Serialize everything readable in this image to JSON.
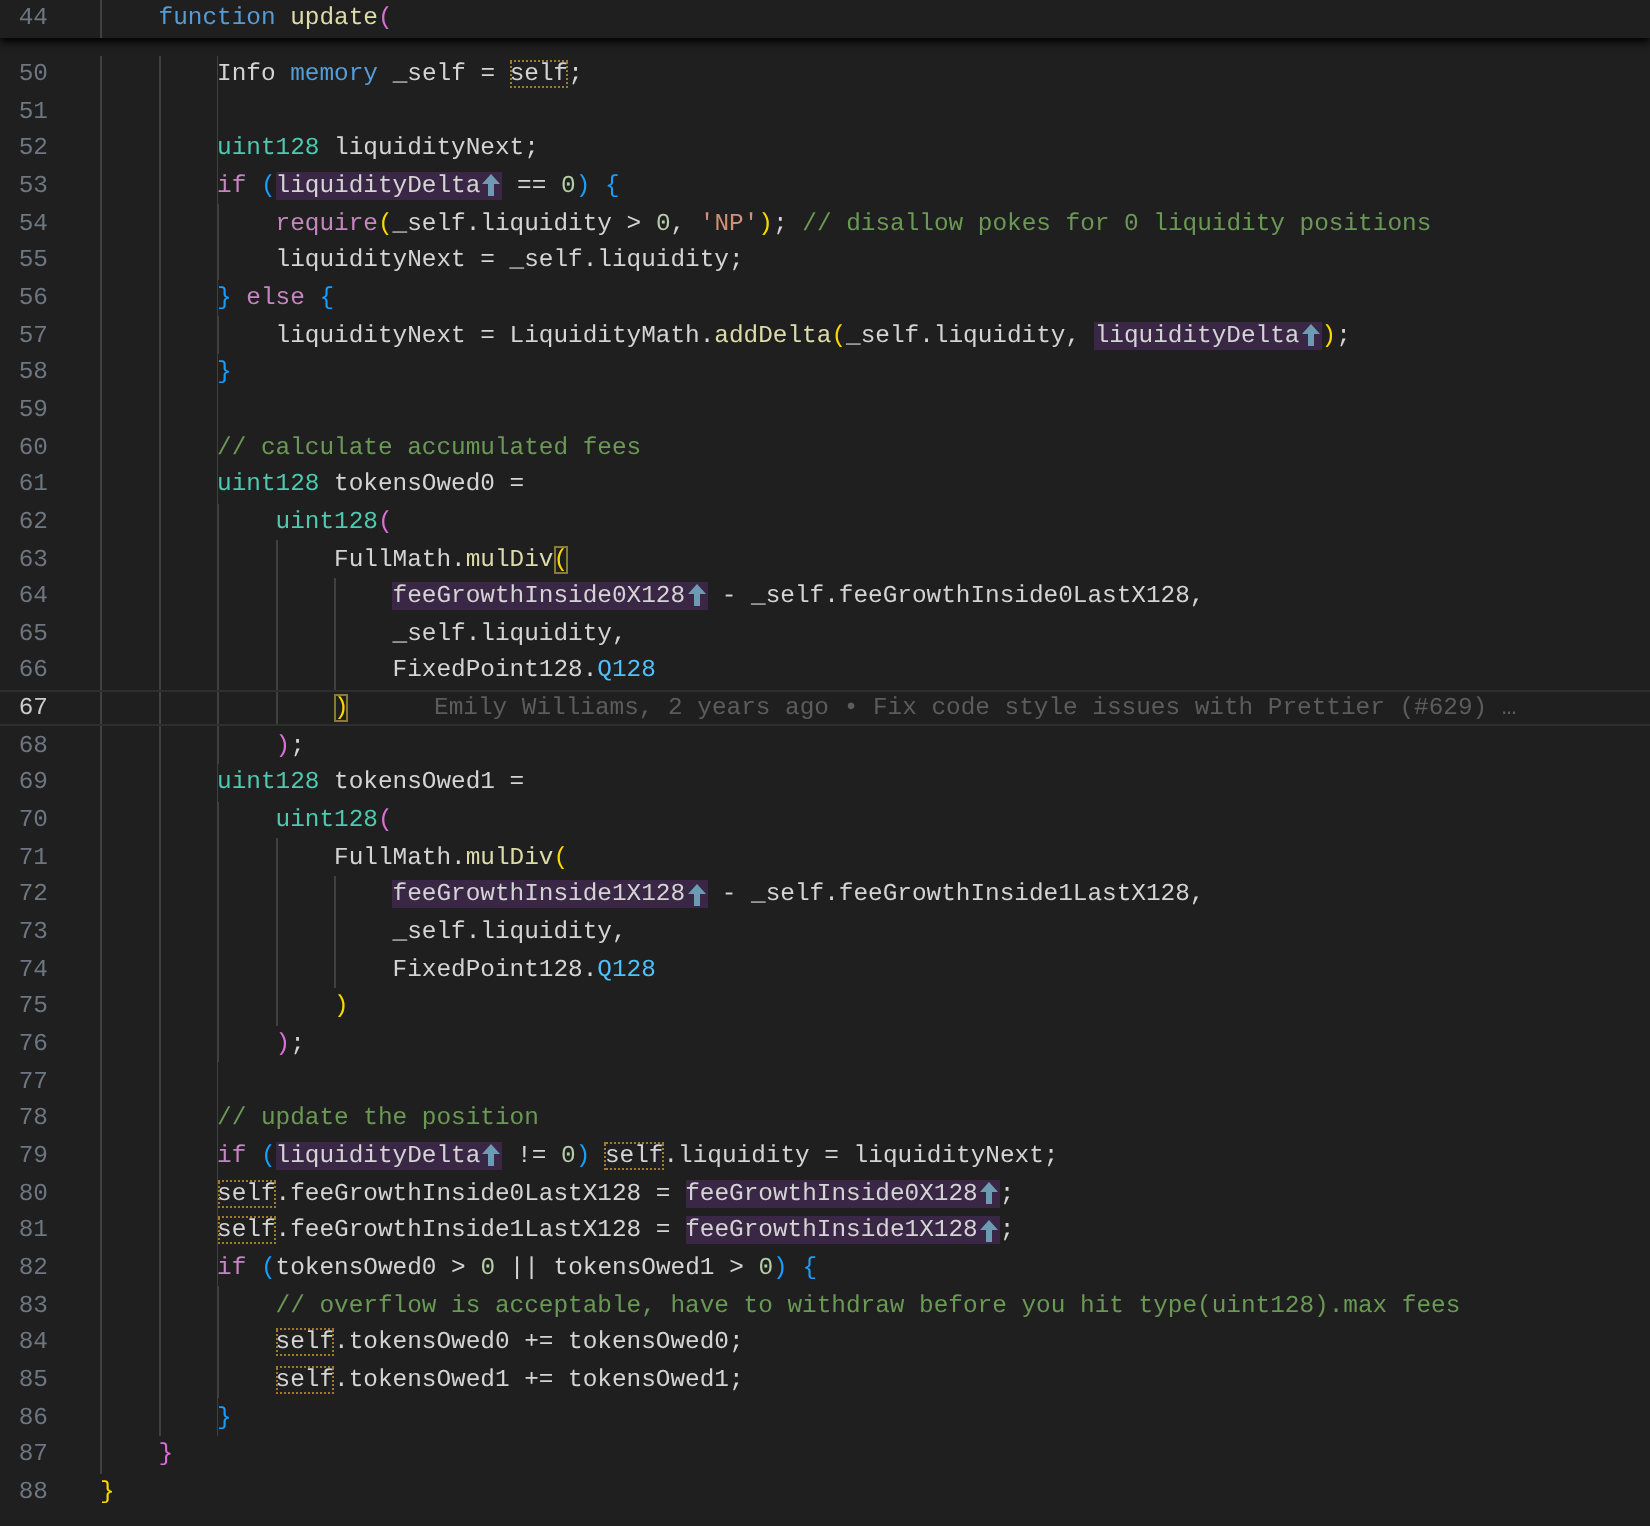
{
  "sticky_line": {
    "number": "44",
    "tokens": [
      {
        "text": "    function",
        "kind": "keyword"
      },
      {
        "text": " update",
        "kind": "function"
      },
      {
        "text": "(",
        "kind": "bracket2"
      }
    ]
  },
  "lines": [
    {
      "number": "50",
      "current": false,
      "tokens": [
        {
          "text": "        Info",
          "kind": "plain"
        },
        {
          "text": " memory",
          "kind": "keyword"
        },
        {
          "text": " _self = ",
          "kind": "plain"
        },
        {
          "text": "self",
          "kind": "self"
        },
        {
          "text": ";",
          "kind": "plain"
        }
      ]
    },
    {
      "number": "51",
      "current": false
    },
    {
      "number": "52",
      "current": false,
      "tokens": [
        {
          "text": "        uint128",
          "kind": "type"
        },
        {
          "text": " liquidityNext;",
          "kind": "plain"
        }
      ]
    },
    {
      "number": "53",
      "current": false,
      "tokens": [
        {
          "text": "        if",
          "kind": "control"
        },
        {
          "text": " (",
          "kind": "bracket3"
        },
        {
          "text": "liquidityDelta",
          "kind": "param"
        },
        {
          "text": " == ",
          "kind": "plain"
        },
        {
          "text": "0",
          "kind": "number"
        },
        {
          "text": ")",
          "kind": "bracket3"
        },
        {
          "text": " {",
          "kind": "bracket3"
        }
      ]
    },
    {
      "number": "54",
      "current": false,
      "tokens": [
        {
          "text": "            require",
          "kind": "control"
        },
        {
          "text": "(",
          "kind": "bracket1"
        },
        {
          "text": "_self.liquidity > ",
          "kind": "plain"
        },
        {
          "text": "0",
          "kind": "number"
        },
        {
          "text": ", ",
          "kind": "plain"
        },
        {
          "text": "'NP'",
          "kind": "string"
        },
        {
          "text": ")",
          "kind": "bracket1"
        },
        {
          "text": "; ",
          "kind": "plain"
        },
        {
          "text": "// disallow pokes for 0 liquidity positions",
          "kind": "comment"
        }
      ]
    },
    {
      "number": "55",
      "current": false,
      "tokens": [
        {
          "text": "            liquidityNext = _self.liquidity;",
          "kind": "plain"
        }
      ]
    },
    {
      "number": "56",
      "current": false,
      "tokens": [
        {
          "text": "        }",
          "kind": "bracket3"
        },
        {
          "text": " else",
          "kind": "control"
        },
        {
          "text": " {",
          "kind": "bracket3"
        }
      ]
    },
    {
      "number": "57",
      "current": false,
      "tokens": [
        {
          "text": "            liquidityNext = LiquidityMath.",
          "kind": "plain"
        },
        {
          "text": "addDelta",
          "kind": "function"
        },
        {
          "text": "(",
          "kind": "bracket1"
        },
        {
          "text": "_self.liquidity, ",
          "kind": "plain"
        },
        {
          "text": "liquidityDelta",
          "kind": "param"
        },
        {
          "text": ")",
          "kind": "bracket1"
        },
        {
          "text": ";",
          "kind": "plain"
        }
      ]
    },
    {
      "number": "58",
      "current": false,
      "tokens": [
        {
          "text": "        }",
          "kind": "bracket3"
        }
      ]
    },
    {
      "number": "59",
      "current": false
    },
    {
      "number": "60",
      "current": false,
      "tokens": [
        {
          "text": "        // calculate accumulated fees",
          "kind": "comment"
        }
      ]
    },
    {
      "number": "61",
      "current": false,
      "tokens": [
        {
          "text": "        uint128",
          "kind": "type"
        },
        {
          "text": " tokensOwed0 =",
          "kind": "plain"
        }
      ]
    },
    {
      "number": "62",
      "current": false,
      "tokens": [
        {
          "text": "            uint128",
          "kind": "type"
        },
        {
          "text": "(",
          "kind": "bracket2"
        }
      ]
    },
    {
      "number": "63",
      "current": false,
      "tokens": [
        {
          "text": "                FullMath.",
          "kind": "plain"
        },
        {
          "text": "mulDiv",
          "kind": "function"
        },
        {
          "text": "(",
          "kind": "match"
        }
      ]
    },
    {
      "number": "64",
      "current": false,
      "tokens": [
        {
          "text": "                    feeGrowthInside0X128",
          "kind": "param"
        },
        {
          "text": " - _self.feeGrowthInside0LastX128,",
          "kind": "plain"
        }
      ]
    },
    {
      "number": "65",
      "current": false,
      "tokens": [
        {
          "text": "                    _self.liquidity,",
          "kind": "plain"
        }
      ]
    },
    {
      "number": "66",
      "current": false,
      "tokens": [
        {
          "text": "                    FixedPoint128.",
          "kind": "plain"
        },
        {
          "text": "Q128",
          "kind": "constant"
        }
      ]
    },
    {
      "number": "67",
      "current": true,
      "blame": "Emily Williams, 2 years ago • Fix code style issues with Prettier (#629) …",
      "tokens": [
        {
          "text": "                )",
          "kind": "match"
        }
      ]
    },
    {
      "number": "68",
      "current": false,
      "tokens": [
        {
          "text": "            )",
          "kind": "bracket2"
        },
        {
          "text": ";",
          "kind": "plain"
        }
      ]
    },
    {
      "number": "69",
      "current": false,
      "tokens": [
        {
          "text": "        uint128",
          "kind": "type"
        },
        {
          "text": " tokensOwed1 =",
          "kind": "plain"
        }
      ]
    },
    {
      "number": "70",
      "current": false,
      "tokens": [
        {
          "text": "            uint128",
          "kind": "type"
        },
        {
          "text": "(",
          "kind": "bracket2"
        }
      ]
    },
    {
      "number": "71",
      "current": false,
      "tokens": [
        {
          "text": "                FullMath.",
          "kind": "plain"
        },
        {
          "text": "mulDiv",
          "kind": "function"
        },
        {
          "text": "(",
          "kind": "bracket1"
        }
      ]
    },
    {
      "number": "72",
      "current": false,
      "tokens": [
        {
          "text": "                    feeGrowthInside1X128",
          "kind": "param"
        },
        {
          "text": " - _self.feeGrowthInside1LastX128,",
          "kind": "plain"
        }
      ]
    },
    {
      "number": "73",
      "current": false,
      "tokens": [
        {
          "text": "                    _self.liquidity,",
          "kind": "plain"
        }
      ]
    },
    {
      "number": "74",
      "current": false,
      "tokens": [
        {
          "text": "                    FixedPoint128.",
          "kind": "plain"
        },
        {
          "text": "Q128",
          "kind": "constant"
        }
      ]
    },
    {
      "number": "75",
      "current": false,
      "tokens": [
        {
          "text": "                )",
          "kind": "bracket1"
        }
      ]
    },
    {
      "number": "76",
      "current": false,
      "tokens": [
        {
          "text": "            )",
          "kind": "bracket2"
        },
        {
          "text": ";",
          "kind": "plain"
        }
      ]
    },
    {
      "number": "77",
      "current": false
    },
    {
      "number": "78",
      "current": false,
      "tokens": [
        {
          "text": "        // update the position",
          "kind": "comment"
        }
      ]
    },
    {
      "number": "79",
      "current": false,
      "tokens": [
        {
          "text": "        if",
          "kind": "control"
        },
        {
          "text": " (",
          "kind": "bracket3"
        },
        {
          "text": "liquidityDelta",
          "kind": "param"
        },
        {
          "text": " != ",
          "kind": "plain"
        },
        {
          "text": "0",
          "kind": "number"
        },
        {
          "text": ")",
          "kind": "bracket3"
        },
        {
          "text": " self",
          "kind": "self"
        },
        {
          "text": ".liquidity = liquidityNext;",
          "kind": "plain"
        }
      ]
    },
    {
      "number": "80",
      "current": false,
      "tokens": [
        {
          "text": "        self",
          "kind": "self"
        },
        {
          "text": ".feeGrowthInside0LastX128 = ",
          "kind": "plain"
        },
        {
          "text": "feeGrowthInside0X128",
          "kind": "param"
        },
        {
          "text": ";",
          "kind": "plain"
        }
      ]
    },
    {
      "number": "81",
      "current": false,
      "tokens": [
        {
          "text": "        self",
          "kind": "self"
        },
        {
          "text": ".feeGrowthInside1LastX128 = ",
          "kind": "plain"
        },
        {
          "text": "feeGrowthInside1X128",
          "kind": "param"
        },
        {
          "text": ";",
          "kind": "plain"
        }
      ]
    },
    {
      "number": "82",
      "current": false,
      "tokens": [
        {
          "text": "        if",
          "kind": "control"
        },
        {
          "text": " (",
          "kind": "bracket3"
        },
        {
          "text": "tokensOwed0 > ",
          "kind": "plain"
        },
        {
          "text": "0",
          "kind": "number"
        },
        {
          "text": " || tokensOwed1 > ",
          "kind": "plain"
        },
        {
          "text": "0",
          "kind": "number"
        },
        {
          "text": ")",
          "kind": "bracket3"
        },
        {
          "text": " {",
          "kind": "bracket3"
        }
      ]
    },
    {
      "number": "83",
      "current": false,
      "tokens": [
        {
          "text": "            // overflow is acceptable, have to withdraw before you hit type(uint128).max fees",
          "kind": "comment"
        }
      ]
    },
    {
      "number": "84",
      "current": false,
      "tokens": [
        {
          "text": "            self",
          "kind": "self"
        },
        {
          "text": ".tokensOwed0 += tokensOwed0;",
          "kind": "plain"
        }
      ]
    },
    {
      "number": "85",
      "current": false,
      "tokens": [
        {
          "text": "            self",
          "kind": "self"
        },
        {
          "text": ".tokensOwed1 += tokensOwed1;",
          "kind": "plain"
        }
      ]
    },
    {
      "number": "86",
      "current": false,
      "tokens": [
        {
          "text": "        }",
          "kind": "bracket3"
        }
      ]
    },
    {
      "number": "87",
      "current": false,
      "tokens": [
        {
          "text": "    }",
          "kind": "bracket2"
        }
      ]
    },
    {
      "number": "88",
      "current": false,
      "tokens": [
        {
          "text": "}",
          "kind": "bracket1"
        }
      ]
    }
  ]
}
